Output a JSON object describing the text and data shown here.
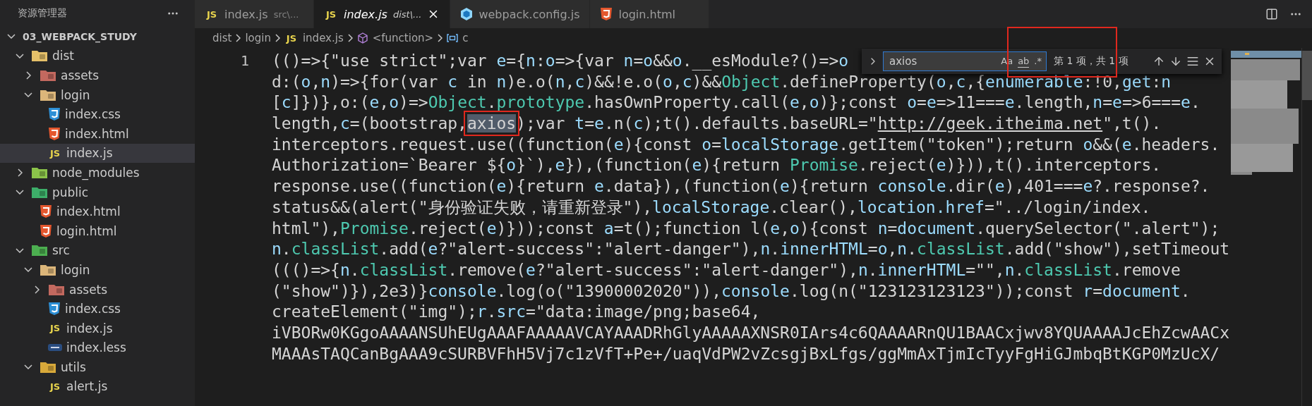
{
  "sidebar": {
    "title": "资源管理器",
    "tree": [
      {
        "kind": "rootfolder",
        "label": "03_WEBPACK_STUDY",
        "expanded": true,
        "selected": false,
        "children": [
          {
            "kind": "distfolder",
            "label": "dist",
            "expanded": true,
            "selected": false,
            "children": [
              {
                "kind": "assetsfolder",
                "label": "assets",
                "expanded": false,
                "selected": false
              },
              {
                "kind": "folder",
                "label": "login",
                "expanded": true,
                "selected": false,
                "children": [
                  {
                    "kind": "css",
                    "label": "index.css",
                    "selected": false
                  },
                  {
                    "kind": "html",
                    "label": "index.html",
                    "selected": false
                  },
                  {
                    "kind": "js",
                    "badge": "JS",
                    "label": "index.js",
                    "selected": true
                  }
                ]
              }
            ]
          },
          {
            "kind": "nodefolder",
            "label": "node_modules",
            "expanded": false,
            "selected": false
          },
          {
            "kind": "publicfolder",
            "label": "public",
            "expanded": true,
            "selected": false,
            "children": [
              {
                "kind": "html",
                "label": "index.html",
                "selected": false
              },
              {
                "kind": "html",
                "label": "login.html",
                "selected": false
              }
            ]
          },
          {
            "kind": "srcfolder",
            "label": "src",
            "expanded": true,
            "selected": false,
            "children": [
              {
                "kind": "folder",
                "label": "login",
                "expanded": true,
                "selected": false,
                "children": [
                  {
                    "kind": "assetsfolder",
                    "label": "assets",
                    "expanded": false,
                    "selected": false
                  },
                  {
                    "kind": "css",
                    "label": "index.css",
                    "selected": false
                  },
                  {
                    "kind": "js",
                    "badge": "JS",
                    "label": "index.js",
                    "selected": false
                  },
                  {
                    "kind": "less",
                    "label": "index.less",
                    "selected": false
                  }
                ]
              },
              {
                "kind": "utilsfolder",
                "label": "utils",
                "expanded": true,
                "selected": false,
                "children": [
                  {
                    "kind": "js",
                    "badge": "JS",
                    "label": "alert.js",
                    "selected": false
                  }
                ]
              }
            ]
          }
        ]
      }
    ]
  },
  "tabs": [
    {
      "kind": "js",
      "badge": "JS",
      "label": "index.js",
      "detail": "src\\...",
      "selected": false,
      "preview": false
    },
    {
      "kind": "js",
      "badge": "JS",
      "label": "index.js",
      "detail": "dist\\...",
      "selected": true,
      "preview": true
    },
    {
      "kind": "webpack",
      "label": "webpack.config.js",
      "selected": false,
      "preview": false
    },
    {
      "kind": "html",
      "label": "login.html",
      "selected": false,
      "preview": false
    }
  ],
  "breadcrumb": [
    {
      "kind": "folder",
      "label": "dist"
    },
    {
      "kind": "folder",
      "label": "login"
    },
    {
      "kind": "js",
      "badge": "JS",
      "label": "index.js"
    },
    {
      "kind": "function",
      "label": "<function>"
    },
    {
      "kind": "variable",
      "label": "c"
    }
  ],
  "editor": {
    "line_number": "1",
    "lines": [
      [
        {
          "kind": "plain",
          "text": "(()=>{\"use strict\";var "
        },
        {
          "kind": "var",
          "text": "e"
        },
        {
          "kind": "plain",
          "text": "={"
        },
        {
          "kind": "var",
          "text": "n"
        },
        {
          "kind": "plain",
          "text": ":"
        },
        {
          "kind": "var",
          "text": "o"
        },
        {
          "kind": "plain",
          "text": "=>{var "
        },
        {
          "kind": "var",
          "text": "n"
        },
        {
          "kind": "plain",
          "text": "="
        },
        {
          "kind": "var",
          "text": "o"
        },
        {
          "kind": "plain",
          "text": "&&"
        },
        {
          "kind": "var",
          "text": "o"
        },
        {
          "kind": "plain",
          "text": ".__esModule?()=>"
        },
        {
          "kind": "var",
          "text": "o"
        }
      ],
      [
        {
          "kind": "plain",
          "text": "d:("
        },
        {
          "kind": "var",
          "text": "o"
        },
        {
          "kind": "plain",
          "text": ","
        },
        {
          "kind": "var",
          "text": "n"
        },
        {
          "kind": "plain",
          "text": ")=>{for(var "
        },
        {
          "kind": "var",
          "text": "c"
        },
        {
          "kind": "plain",
          "text": " in "
        },
        {
          "kind": "var",
          "text": "n"
        },
        {
          "kind": "plain",
          "text": ")e.o("
        },
        {
          "kind": "var",
          "text": "n"
        },
        {
          "kind": "plain",
          "text": ","
        },
        {
          "kind": "var",
          "text": "c"
        },
        {
          "kind": "plain",
          "text": ")&&!e.o("
        },
        {
          "kind": "var",
          "text": "o"
        },
        {
          "kind": "plain",
          "text": ","
        },
        {
          "kind": "var",
          "text": "c"
        },
        {
          "kind": "plain",
          "text": ")&&"
        },
        {
          "kind": "type",
          "text": "Object"
        },
        {
          "kind": "plain",
          "text": ".defineProperty("
        },
        {
          "kind": "var",
          "text": "o"
        },
        {
          "kind": "plain",
          "text": ","
        },
        {
          "kind": "var",
          "text": "c"
        },
        {
          "kind": "plain",
          "text": ",{"
        },
        {
          "kind": "var",
          "text": "enumerable"
        },
        {
          "kind": "plain",
          "text": ":!0,"
        },
        {
          "kind": "var",
          "text": "get"
        },
        {
          "kind": "plain",
          "text": ":"
        },
        {
          "kind": "var",
          "text": "n"
        }
      ],
      [
        {
          "kind": "plain",
          "text": "["
        },
        {
          "kind": "var",
          "text": "c"
        },
        {
          "kind": "plain",
          "text": "]})},o:("
        },
        {
          "kind": "var",
          "text": "e"
        },
        {
          "kind": "plain",
          "text": ","
        },
        {
          "kind": "var",
          "text": "o"
        },
        {
          "kind": "plain",
          "text": ")=>"
        },
        {
          "kind": "type",
          "text": "Object"
        },
        {
          "kind": "plain",
          "text": "."
        },
        {
          "kind": "type",
          "text": "prototype"
        },
        {
          "kind": "plain",
          "text": ".hasOwnProperty.call("
        },
        {
          "kind": "var",
          "text": "e"
        },
        {
          "kind": "plain",
          "text": ","
        },
        {
          "kind": "var",
          "text": "o"
        },
        {
          "kind": "plain",
          "text": ")};const "
        },
        {
          "kind": "var",
          "text": "o"
        },
        {
          "kind": "plain",
          "text": "="
        },
        {
          "kind": "var",
          "text": "e"
        },
        {
          "kind": "plain",
          "text": "=>11==="
        },
        {
          "kind": "var",
          "text": "e"
        },
        {
          "kind": "plain",
          "text": ".length,"
        },
        {
          "kind": "var",
          "text": "n"
        },
        {
          "kind": "plain",
          "text": "="
        },
        {
          "kind": "var",
          "text": "e"
        },
        {
          "kind": "plain",
          "text": "=>6==="
        },
        {
          "kind": "var",
          "text": "e"
        },
        {
          "kind": "plain",
          "text": "."
        }
      ],
      [
        {
          "kind": "plain",
          "text": "length,"
        },
        {
          "kind": "var",
          "text": "c"
        },
        {
          "kind": "plain",
          "text": "=(bootstrap,"
        },
        {
          "kind": "match",
          "text": "axios"
        },
        {
          "kind": "plain",
          "text": ");var "
        },
        {
          "kind": "var",
          "text": "t"
        },
        {
          "kind": "plain",
          "text": "="
        },
        {
          "kind": "var",
          "text": "e"
        },
        {
          "kind": "plain",
          "text": ".n("
        },
        {
          "kind": "var",
          "text": "c"
        },
        {
          "kind": "plain",
          "text": ");t().defaults.baseURL=\""
        },
        {
          "kind": "link",
          "text": "http://geek.itheima.net"
        },
        {
          "kind": "plain",
          "text": "\",t()."
        }
      ],
      [
        {
          "kind": "plain",
          "text": "interceptors.request.use((function("
        },
        {
          "kind": "var",
          "text": "e"
        },
        {
          "kind": "plain",
          "text": "){const "
        },
        {
          "kind": "var",
          "text": "o"
        },
        {
          "kind": "plain",
          "text": "="
        },
        {
          "kind": "var",
          "text": "localStorage"
        },
        {
          "kind": "plain",
          "text": ".getItem(\"token\");return "
        },
        {
          "kind": "var",
          "text": "o"
        },
        {
          "kind": "plain",
          "text": "&&("
        },
        {
          "kind": "var",
          "text": "e"
        },
        {
          "kind": "plain",
          "text": ".headers."
        }
      ],
      [
        {
          "kind": "plain",
          "text": "Authorization=`Bearer ${"
        },
        {
          "kind": "var",
          "text": "o"
        },
        {
          "kind": "plain",
          "text": "}`),"
        },
        {
          "kind": "var",
          "text": "e"
        },
        {
          "kind": "plain",
          "text": "}),(function("
        },
        {
          "kind": "var",
          "text": "e"
        },
        {
          "kind": "plain",
          "text": "){return "
        },
        {
          "kind": "type",
          "text": "Promise"
        },
        {
          "kind": "plain",
          "text": ".reject("
        },
        {
          "kind": "var",
          "text": "e"
        },
        {
          "kind": "plain",
          "text": ")})),t().interceptors."
        }
      ],
      [
        {
          "kind": "plain",
          "text": "response.use((function("
        },
        {
          "kind": "var",
          "text": "e"
        },
        {
          "kind": "plain",
          "text": "){return "
        },
        {
          "kind": "var",
          "text": "e"
        },
        {
          "kind": "plain",
          "text": ".data}),(function("
        },
        {
          "kind": "var",
          "text": "e"
        },
        {
          "kind": "plain",
          "text": "){return "
        },
        {
          "kind": "var",
          "text": "console"
        },
        {
          "kind": "plain",
          "text": ".dir("
        },
        {
          "kind": "var",
          "text": "e"
        },
        {
          "kind": "plain",
          "text": "),401==="
        },
        {
          "kind": "var",
          "text": "e"
        },
        {
          "kind": "plain",
          "text": "?.response?."
        }
      ],
      [
        {
          "kind": "plain",
          "text": "status&&(alert(\"身份验证失败，请重新登录\"),"
        },
        {
          "kind": "var",
          "text": "localStorage"
        },
        {
          "kind": "plain",
          "text": ".clear(),"
        },
        {
          "kind": "var",
          "text": "location.href"
        },
        {
          "kind": "plain",
          "text": "=\"../login/index."
        }
      ],
      [
        {
          "kind": "plain",
          "text": "html\"),"
        },
        {
          "kind": "type",
          "text": "Promise"
        },
        {
          "kind": "plain",
          "text": ".reject("
        },
        {
          "kind": "var",
          "text": "e"
        },
        {
          "kind": "plain",
          "text": ")}));const "
        },
        {
          "kind": "var",
          "text": "a"
        },
        {
          "kind": "plain",
          "text": "=t();function l("
        },
        {
          "kind": "var",
          "text": "e"
        },
        {
          "kind": "plain",
          "text": ","
        },
        {
          "kind": "var",
          "text": "o"
        },
        {
          "kind": "plain",
          "text": "){const "
        },
        {
          "kind": "var",
          "text": "n"
        },
        {
          "kind": "plain",
          "text": "="
        },
        {
          "kind": "var",
          "text": "document"
        },
        {
          "kind": "plain",
          "text": ".querySelector(\".alert\");"
        }
      ],
      [
        {
          "kind": "var",
          "text": "n"
        },
        {
          "kind": "plain",
          "text": "."
        },
        {
          "kind": "type",
          "text": "classList"
        },
        {
          "kind": "plain",
          "text": ".add("
        },
        {
          "kind": "var",
          "text": "e"
        },
        {
          "kind": "plain",
          "text": "?\"alert-success\":\"alert-danger\"),"
        },
        {
          "kind": "var",
          "text": "n"
        },
        {
          "kind": "plain",
          "text": "."
        },
        {
          "kind": "var",
          "text": "innerHTML"
        },
        {
          "kind": "plain",
          "text": "="
        },
        {
          "kind": "var",
          "text": "o"
        },
        {
          "kind": "plain",
          "text": ","
        },
        {
          "kind": "var",
          "text": "n"
        },
        {
          "kind": "plain",
          "text": "."
        },
        {
          "kind": "type",
          "text": "classList"
        },
        {
          "kind": "plain",
          "text": ".add(\"show\"),setTimeout"
        }
      ],
      [
        {
          "kind": "plain",
          "text": "((()=>{"
        },
        {
          "kind": "var",
          "text": "n"
        },
        {
          "kind": "plain",
          "text": "."
        },
        {
          "kind": "type",
          "text": "classList"
        },
        {
          "kind": "plain",
          "text": ".remove("
        },
        {
          "kind": "var",
          "text": "e"
        },
        {
          "kind": "plain",
          "text": "?\"alert-success\":\"alert-danger\"),"
        },
        {
          "kind": "var",
          "text": "n"
        },
        {
          "kind": "plain",
          "text": "."
        },
        {
          "kind": "var",
          "text": "innerHTML"
        },
        {
          "kind": "plain",
          "text": "=\"\","
        },
        {
          "kind": "var",
          "text": "n"
        },
        {
          "kind": "plain",
          "text": "."
        },
        {
          "kind": "type",
          "text": "classList"
        },
        {
          "kind": "plain",
          "text": ".remove"
        }
      ],
      [
        {
          "kind": "plain",
          "text": "(\"show\")}),2e3)}"
        },
        {
          "kind": "var",
          "text": "console"
        },
        {
          "kind": "plain",
          "text": ".log(o(\"13900002020\")),"
        },
        {
          "kind": "var",
          "text": "console"
        },
        {
          "kind": "plain",
          "text": ".log(n(\"123123123123\"));const "
        },
        {
          "kind": "var",
          "text": "r"
        },
        {
          "kind": "plain",
          "text": "="
        },
        {
          "kind": "var",
          "text": "document"
        },
        {
          "kind": "plain",
          "text": "."
        }
      ],
      [
        {
          "kind": "plain",
          "text": "createElement(\"img\");"
        },
        {
          "kind": "var",
          "text": "r"
        },
        {
          "kind": "plain",
          "text": "."
        },
        {
          "kind": "var",
          "text": "src"
        },
        {
          "kind": "plain",
          "text": "=\"data:image/png;base64,"
        }
      ],
      [
        {
          "kind": "plain",
          "text": "iVBORw0KGgoAAAANSUhEUgAAAFAAAAAVCAYAAADRhGlyAAAAAXNSR0IArs4c6QAAAARnQU1BAACxjwv8YQUAAAAJcEhZcwAACx"
        }
      ],
      [
        {
          "kind": "plain",
          "text": "MAAAsTAQCanBgAAA9cSURBVFhH5Vj7c1zVfT+Pe+/uaqVdPW2vZcsgjBxLfgs/ggMmAxTjmIcTyyFgHiGJmbqBtKGP0MzUcX/"
        }
      ]
    ]
  },
  "find": {
    "replace_expanded": false,
    "value": "axios",
    "options": [
      {
        "label": "Aa",
        "kind": "plain"
      },
      {
        "label": "ab",
        "kind": "underlined"
      },
      {
        "label": ".*",
        "kind": "plain"
      }
    ],
    "count": "第 1 项，共 1 项",
    "count_annotated": true
  }
}
